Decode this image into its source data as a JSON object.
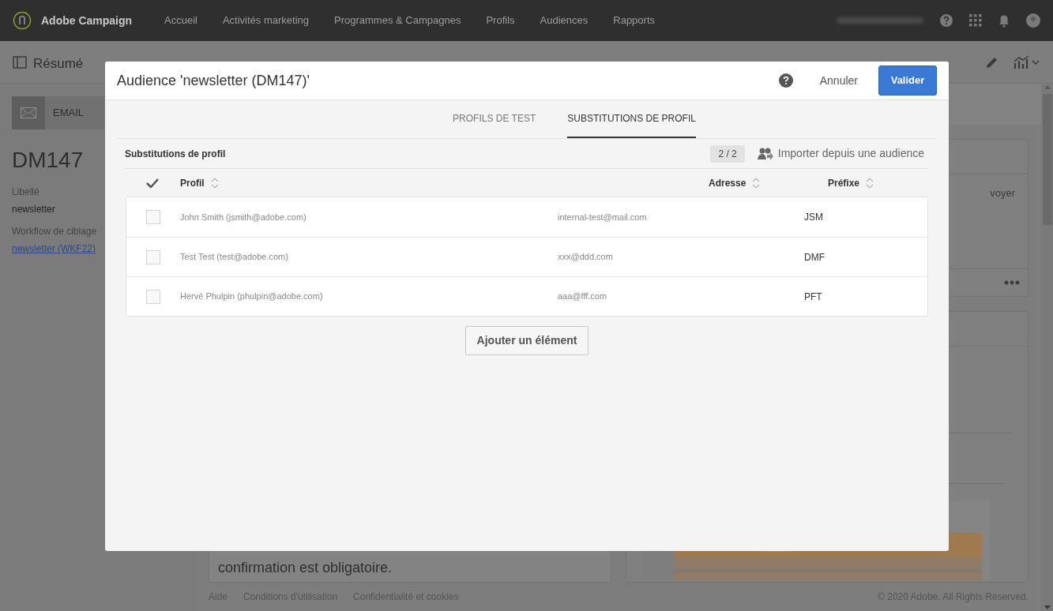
{
  "app": {
    "name": "Adobe Campaign"
  },
  "nav": [
    {
      "label": "Accueil"
    },
    {
      "label": "Activités marketing"
    },
    {
      "label": "Programmes & Campagnes"
    },
    {
      "label": "Profils"
    },
    {
      "label": "Audiences"
    },
    {
      "label": "Rapports"
    }
  ],
  "page_header": {
    "title": "Résumé"
  },
  "summary": {
    "channel": "EMAIL",
    "code": "DM147",
    "fields": [
      {
        "label": "Libellé",
        "value": "newsletter",
        "kind": "text"
      },
      {
        "label": "Workflow de ciblage",
        "value": "newsletter (WKF22)",
        "kind": "link"
      }
    ]
  },
  "background_texts": {
    "cut_right": "voyer",
    "body": "confirmation est obligatoire."
  },
  "footer": {
    "links": [
      "Aide",
      "Conditions d'utilisation",
      "Confidentialité et cookies"
    ],
    "copyright": "© 2020 Adobe. All Rights Reserved."
  },
  "dialog": {
    "title": "Audience 'newsletter (DM147)'",
    "cancel": "Annuler",
    "confirm": "Valider",
    "tabs": [
      {
        "label": "PROFILS DE TEST",
        "selected": false
      },
      {
        "label": "SUBSTITUTIONS DE PROFIL",
        "selected": true
      }
    ],
    "section_title": "Substitutions de profil",
    "count": "2 / 2",
    "import": "Importer depuis une audience",
    "columns": [
      "Profil",
      "Adresse",
      "Préfixe"
    ],
    "rows": [
      {
        "profile": "John Smith (jsmith@adobe.com)",
        "address": "internal-test@mail.com",
        "prefix": "JSM",
        "checked": false
      },
      {
        "profile": "Test Test (test@adobe.com)",
        "address": "xxx@ddd.com",
        "prefix": "DMF",
        "checked": false
      },
      {
        "profile": "Hervé Phulpin (phulpin@adobe.com)",
        "address": "aaa@fff.com",
        "prefix": "PFT",
        "checked": false
      }
    ],
    "add_button": "Ajouter un élément"
  }
}
